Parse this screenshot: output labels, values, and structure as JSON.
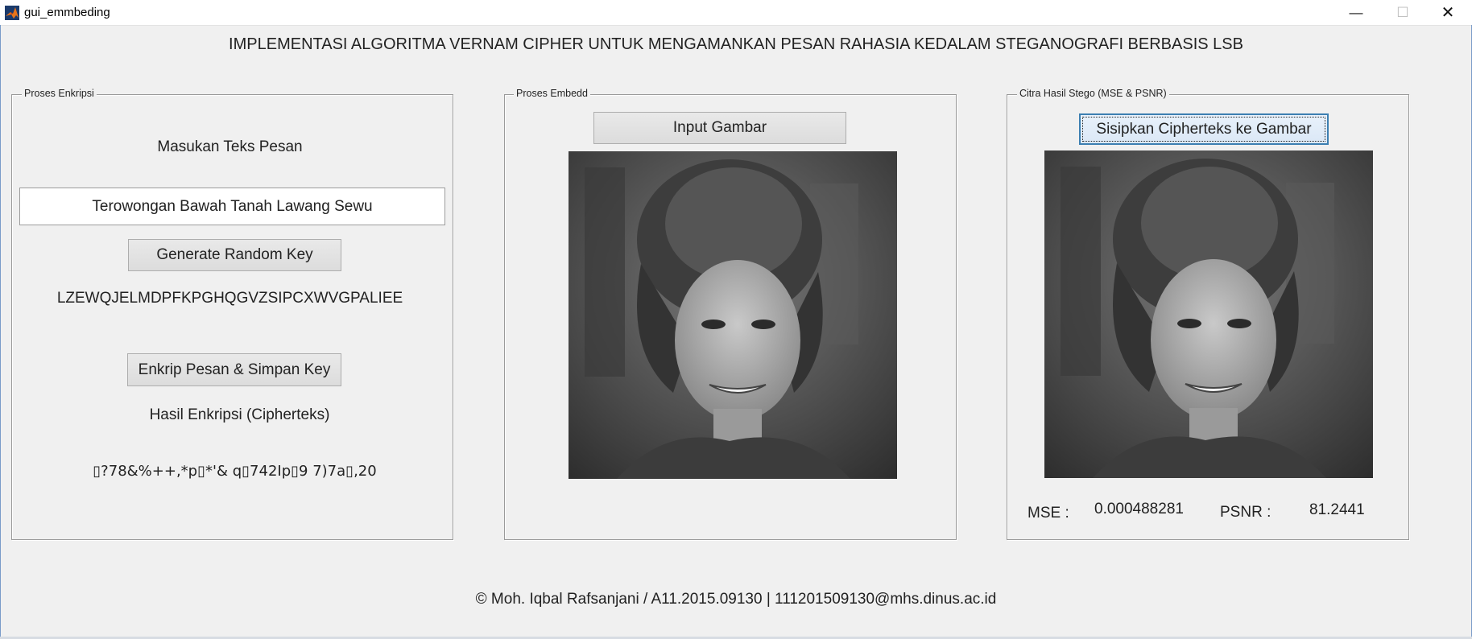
{
  "window": {
    "title": "gui_emmbeding",
    "controls": {
      "minimize": "—",
      "maximize": "☐",
      "close": "✕"
    }
  },
  "heading": "IMPLEMENTASI ALGORITMA VERNAM CIPHER UNTUK MENGAMANKAN PESAN RAHASIA KEDALAM STEGANOGRAFI BERBASIS LSB",
  "encrypt_panel": {
    "title": "Proses Enkripsi",
    "message_label": "Masukan Teks Pesan",
    "message_value": "Terowongan Bawah Tanah Lawang Sewu",
    "generate_key_button": "Generate Random Key",
    "key_value": "LZEWQJELMDPFKPGHQGVZSIPCXWVGPALIEE",
    "encrypt_button": "Enkrip Pesan & Simpan Key",
    "ciphertext_label": "Hasil Enkripsi (Cipherteks)",
    "ciphertext_value": "▯?78&%++,*p▯*'& q▯742Ip▯9 7)7a▯,20"
  },
  "embed_panel": {
    "title": "Proses Embedd",
    "input_image_button": "Input Gambar",
    "image_icon": "portrait-photo-icon"
  },
  "stego_panel": {
    "title": "Citra Hasil Stego (MSE & PSNR)",
    "embed_button": "Sisipkan Cipherteks ke Gambar",
    "image_icon": "portrait-photo-icon",
    "mse_label": "MSE :",
    "mse_value": "0.000488281",
    "psnr_label": "PSNR :",
    "psnr_value": "81.2441"
  },
  "footer": "© Moh. Iqbal Rafsanjani / A11.2015.09130  | 111201509130@mhs.dinus.ac.id",
  "colors": {
    "background": "#f0f0f0",
    "focus_border": "#3c7fb1",
    "frame": "#7a9cc9"
  }
}
